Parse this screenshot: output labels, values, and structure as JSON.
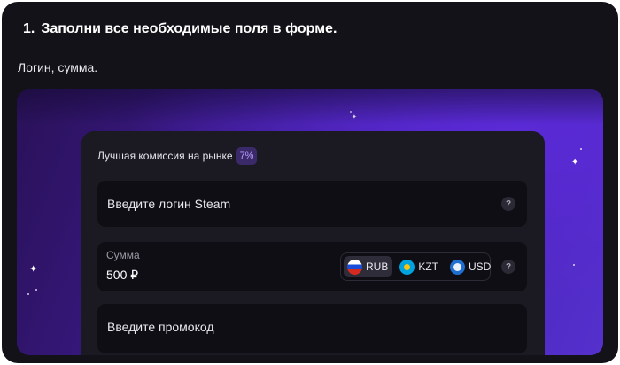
{
  "step": {
    "number": "1.",
    "title": "Заполни все необходимые поля в форме."
  },
  "subtitle": "Логин, сумма.",
  "form": {
    "promo_text": "Лучшая комиссия на рынке",
    "promo_badge": "7%",
    "login": {
      "placeholder": "Введите логин Steam",
      "help": "?"
    },
    "amount": {
      "label": "Сумма",
      "value": "500 ₽",
      "help": "?",
      "selected_currency": "RUB",
      "currencies": [
        {
          "code": "RUB",
          "icon": "russia-flag-icon"
        },
        {
          "code": "KZT",
          "icon": "kazakhstan-flag-icon"
        },
        {
          "code": "USD",
          "icon": "usa-flag-icon"
        }
      ]
    },
    "promo_code": {
      "placeholder": "Введите промокод"
    }
  },
  "colors": {
    "background": "#131218",
    "panel": "#1b1a22",
    "field": "#0f0e14",
    "accent_purple": "#4a22b8",
    "badge_text": "#b99cff"
  }
}
